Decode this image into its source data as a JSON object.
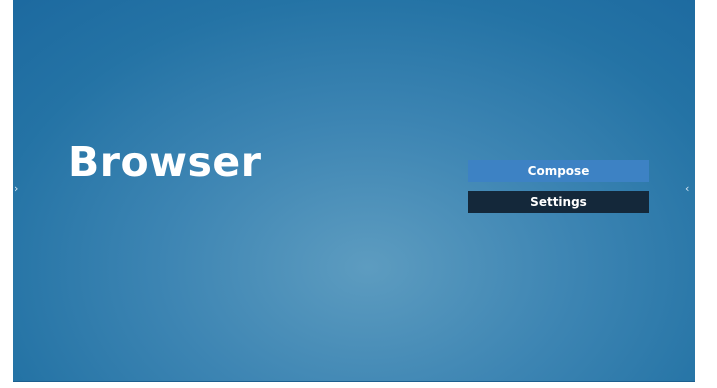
{
  "app": {
    "title": "Browser"
  },
  "menu": {
    "items": [
      {
        "label": "Compose",
        "selected": true
      },
      {
        "label": "Settings",
        "selected": false
      }
    ]
  },
  "nav": {
    "left_arrow": "›",
    "right_arrow": "‹"
  },
  "colors": {
    "background": "#2473a5",
    "compose_button": "#3d82c4",
    "settings_button": "#14283a",
    "text": "#ffffff"
  }
}
